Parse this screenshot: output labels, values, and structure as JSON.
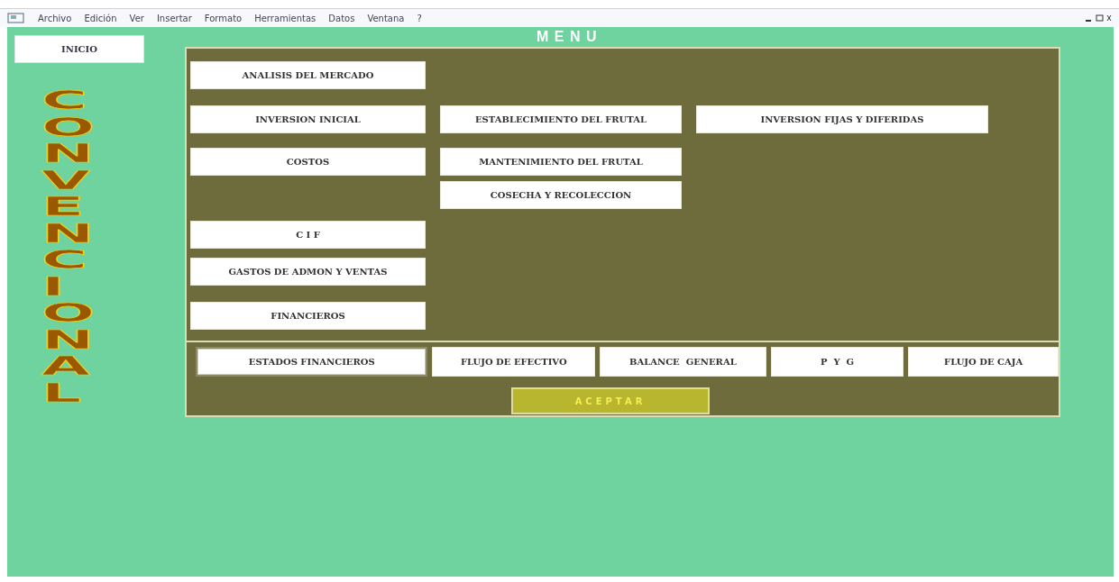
{
  "menu_bar": [
    "Archivo",
    "Edición",
    "Ver",
    "Insertar",
    "Formato",
    "Herramientas",
    "Datos",
    "Ventana",
    "?"
  ],
  "inicio_button": "INICIO",
  "logo_text": "CONVENCIONAL",
  "title": "M E N U",
  "menu_rows": [
    {
      "buttons": [
        {
          "label": "ANALISIS DEL MERCADO",
          "kind": "main"
        }
      ]
    },
    {
      "buttons": [
        {
          "label": "INVERSION INICIAL",
          "kind": "main"
        },
        {
          "label": "ESTABLECIMIENTO DEL FRUTAL",
          "kind": "sub"
        },
        {
          "label": "INVERSION FIJAS Y DIFERIDAS",
          "kind": "extra"
        }
      ]
    },
    {
      "buttons": [
        {
          "label": "COSTOS",
          "kind": "main"
        },
        {
          "label": "MANTENIMIENTO DEL FRUTAL",
          "kind": "sub"
        }
      ]
    },
    {
      "buttons": [
        {
          "label": "COSECHA Y RECOLECCION",
          "kind": "sub"
        }
      ]
    },
    {
      "buttons": [
        {
          "label": "C I F",
          "kind": "main"
        }
      ]
    },
    {
      "buttons": [
        {
          "label": "GASTOS DE ADMON Y VENTAS",
          "kind": "main"
        }
      ]
    },
    {
      "buttons": [
        {
          "label": "FINANCIEROS",
          "kind": "main"
        }
      ]
    }
  ],
  "report_tabs": [
    {
      "label": "ESTADOS FINANCIEROS",
      "selected": true
    },
    {
      "label": "FLUJO DE EFECTIVO",
      "selected": false
    },
    {
      "label": "BALANCE  GENERAL",
      "selected": false
    },
    {
      "label": "P  Y  G",
      "selected": false
    },
    {
      "label": "FLUJO DE CAJA",
      "selected": false
    }
  ],
  "accept_button": "ACEPTAR"
}
